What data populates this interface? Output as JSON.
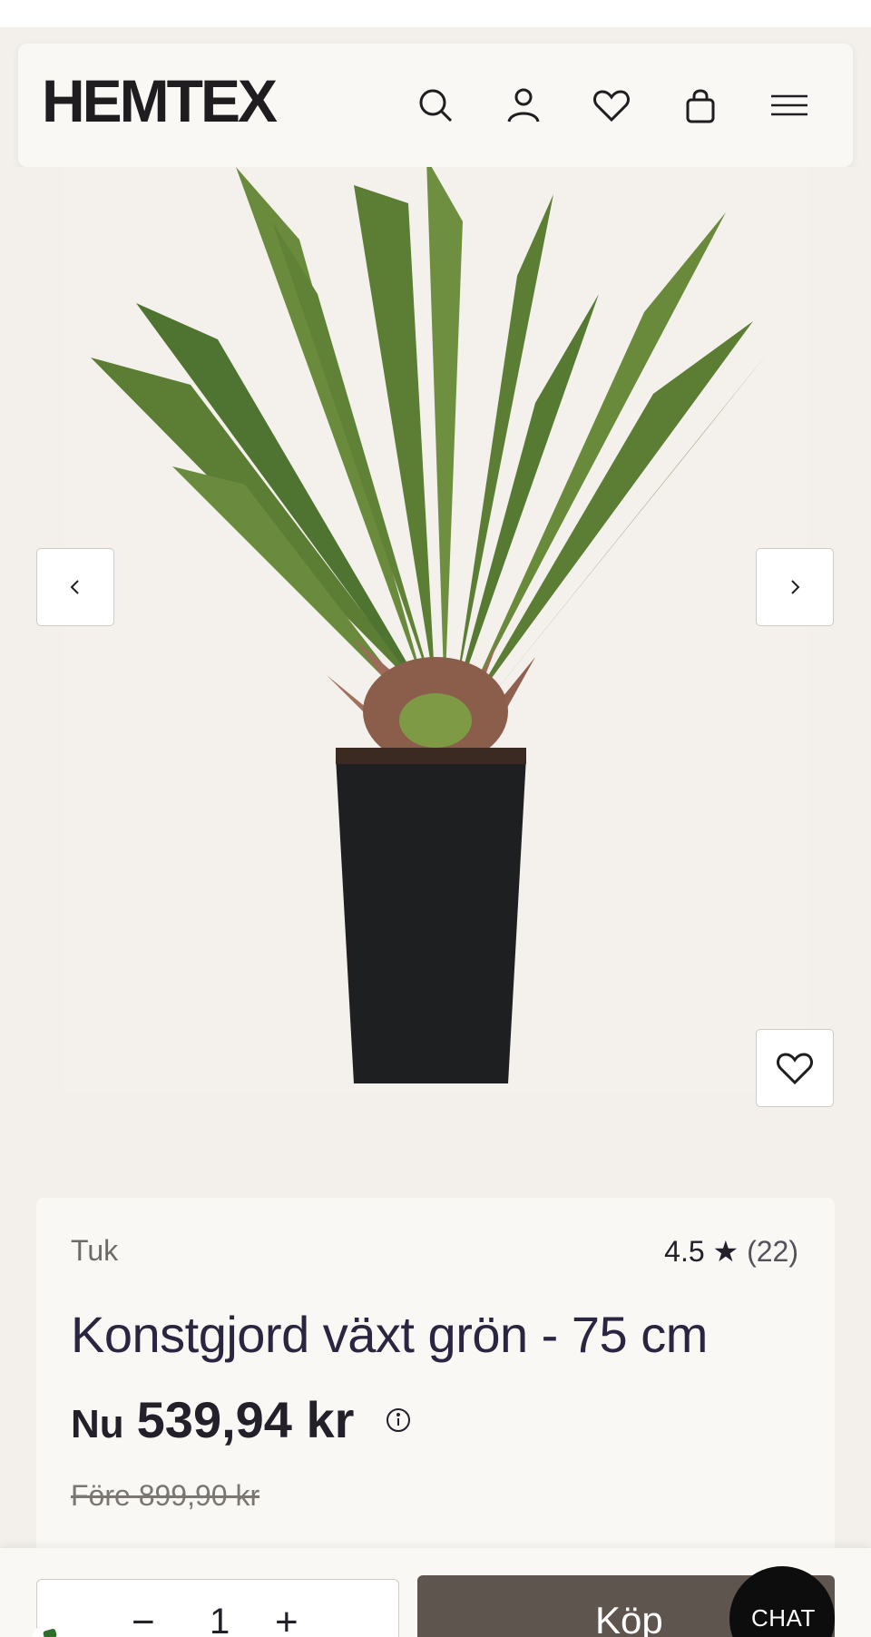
{
  "header": {
    "logo": "HEMTEX",
    "icons": [
      "search-icon",
      "account-icon",
      "heart-icon",
      "bag-icon",
      "menu-icon"
    ]
  },
  "gallery": {
    "prev_icon": "chevron-left-icon",
    "next_icon": "chevron-right-icon",
    "favorite_icon": "heart-icon"
  },
  "product": {
    "brand": "Tuk",
    "rating": "4.5",
    "rating_star": "★",
    "review_count": "(22)",
    "title": "Konstgjord växt grön - 75 cm",
    "price_prefix": "Nu",
    "price": "539,94 kr",
    "old_price": "Före 899,90 kr"
  },
  "purchase": {
    "quantity": "1",
    "minus": "−",
    "plus": "+",
    "buy_label": "Köp"
  },
  "chat": {
    "label": "CHAT"
  },
  "colors": {
    "background": "#f3f0eb",
    "card": "#f9f8f4",
    "buy_button": "#5e554f",
    "chat_button": "#0d0d0d"
  }
}
